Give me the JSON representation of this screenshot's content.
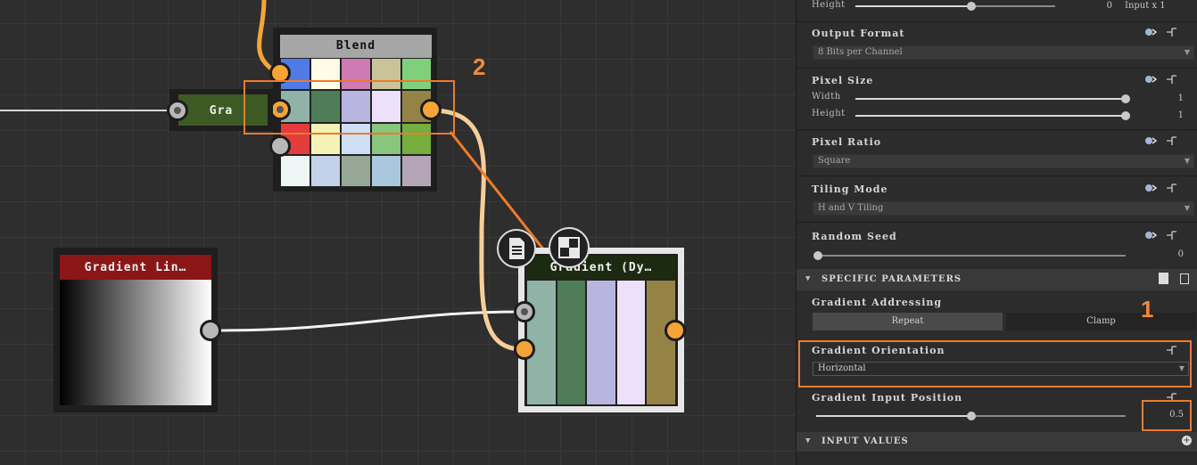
{
  "graph": {
    "blend_node": {
      "title": "Blend",
      "swatches": [
        [
          "#4f7be6",
          "#fffbe6",
          "#d07ab4",
          "#c9c39a",
          "#7fd07b"
        ],
        [
          "#8fb3a6",
          "#4f7d59",
          "#b8b6e0",
          "#ece0fb",
          "#948345"
        ],
        [
          "#e43c3c",
          "#f3f3b5",
          "#cfdff5",
          "#88c57d",
          "#75ad3e"
        ],
        [
          "#eef5f5",
          "#c3d2e8",
          "#98a896",
          "#a9c8dd",
          "#b4a5b6"
        ]
      ]
    },
    "gra_node": {
      "title": "Gra",
      "color": "#3d5a24"
    },
    "gradient_linear_node": {
      "title": "Gradient Lin…",
      "color": "#8a1616"
    },
    "gradient_dyn_node": {
      "title": "Gradient (Dy…",
      "stripes": [
        "#8fb3a6",
        "#4f7d59",
        "#b8b6e0",
        "#ece0fb",
        "#948345"
      ]
    },
    "callout_2": "2"
  },
  "panel": {
    "height_row": {
      "label": "Height",
      "value": "0",
      "suffix": "Input x 1",
      "fraction": 0.58
    },
    "output_format": {
      "title": "Output Format",
      "value": "8 Bits per Channel"
    },
    "pixel_size": {
      "title": "Pixel Size",
      "width_label": "Width",
      "width_value": "1",
      "width_fraction": 1.0,
      "height_label": "Height",
      "height_value": "1",
      "height_fraction": 1.0
    },
    "pixel_ratio": {
      "title": "Pixel Ratio",
      "value": "Square"
    },
    "tiling_mode": {
      "title": "Tiling Mode",
      "value": "H and V Tiling"
    },
    "random_seed": {
      "title": "Random Seed",
      "value": "0",
      "fraction": 0.0
    },
    "specific_header": "SPECIFIC PARAMETERS",
    "gradient_addressing": {
      "title": "Gradient Addressing",
      "option_repeat": "Repeat",
      "option_clamp": "Clamp",
      "selected": "Repeat"
    },
    "gradient_orientation": {
      "title": "Gradient Orientation",
      "value": "Horizontal"
    },
    "gradient_input_position": {
      "title": "Gradient Input Position",
      "value": "0.5",
      "fraction": 0.5
    },
    "input_values_header": "INPUT VALUES",
    "callout_1": "1"
  },
  "colors": {
    "accent": "#ef7a2c",
    "port_orange": "#f6a436",
    "wire_white": "#e6e6e6",
    "wire_peach": "#f5cf9a"
  }
}
